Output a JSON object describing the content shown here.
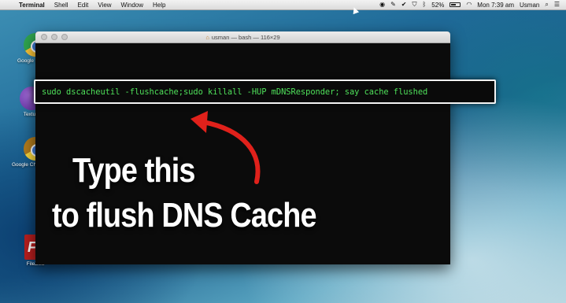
{
  "menubar": {
    "app_name": "Terminal",
    "items": [
      "Shell",
      "Edit",
      "View",
      "Window",
      "Help"
    ],
    "status_icons": [
      "record-icon",
      "feather-icon",
      "checkmark-icon",
      "shield-icon",
      "bluetooth-icon"
    ],
    "battery_level": 0.52,
    "battery_text": "52%",
    "wifi_icon": "wifi-icon",
    "clock": "Mon 7:39 am",
    "user": "Usman"
  },
  "desktop": {
    "icons": [
      {
        "label": "Google Chrome",
        "icon": "chrome-icon"
      },
      {
        "label": "Textual",
        "icon": "textual-icon"
      },
      {
        "label": "Google Chrome Canary",
        "icon": "chrome-canary-icon"
      },
      {
        "label": "FileZilla",
        "icon": "filezilla-icon"
      }
    ]
  },
  "terminal": {
    "title": "usman — bash — 116×29"
  },
  "command": "sudo dscacheutil -flushcache;sudo killall -HUP mDNSResponder; say cache flushed",
  "annotation": {
    "line1": "Type this",
    "line2": "to flush DNS Cache",
    "arrow_color": "#e0211b"
  }
}
